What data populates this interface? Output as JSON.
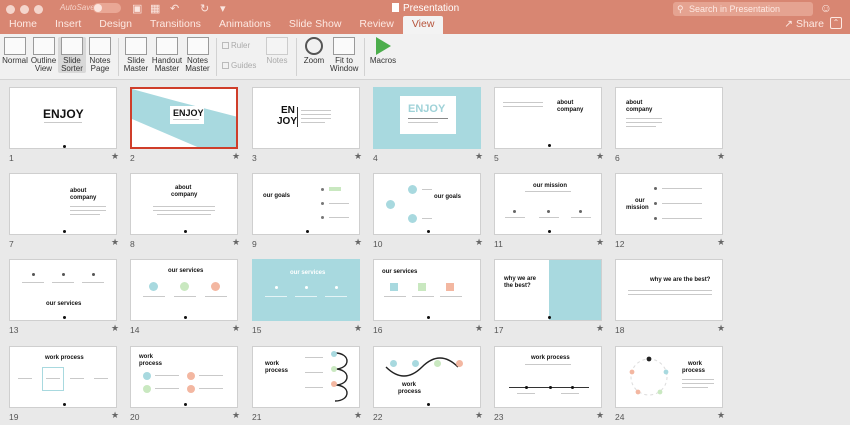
{
  "window": {
    "title": "Presentation",
    "autosave_label": "AutoSave",
    "toggle_label": "OFF",
    "search_placeholder": "Search in Presentation",
    "share_label": "Share"
  },
  "tabs": [
    "Home",
    "Insert",
    "Design",
    "Transitions",
    "Animations",
    "Slide Show",
    "Review",
    "View"
  ],
  "active_tab": "View",
  "ribbon": {
    "normal": "Normal",
    "outline_1": "Outline",
    "outline_2": "View",
    "sorter_1": "Slide",
    "sorter_2": "Sorter",
    "notes_page_1": "Notes",
    "notes_page_2": "Page",
    "slide_master_1": "Slide",
    "slide_master_2": "Master",
    "handout_master_1": "Handout",
    "handout_master_2": "Master",
    "notes_master_1": "Notes",
    "notes_master_2": "Master",
    "ruler": "Ruler",
    "guides": "Guides",
    "notes": "Notes",
    "zoom": "Zoom",
    "fit_1": "Fit to",
    "fit_2": "Window",
    "macros": "Macros"
  },
  "colors": {
    "titlebar": "#d88672",
    "accent_teal": "#a8d9df",
    "accent_green": "#c9e8c0",
    "accent_orange": "#f3b7a1",
    "selection": "#cf3e2a"
  },
  "slides": [
    {
      "number": "1",
      "starred": true,
      "text": [
        "ENJOY"
      ]
    },
    {
      "number": "2",
      "starred": true,
      "selected": true,
      "text": [
        "ENJOY"
      ]
    },
    {
      "number": "3",
      "starred": true,
      "text": [
        "EN",
        "JOY"
      ]
    },
    {
      "number": "4",
      "starred": true,
      "text": [
        "ENJOY"
      ]
    },
    {
      "number": "5",
      "starred": true,
      "text": [
        "about",
        "company"
      ]
    },
    {
      "number": "6",
      "starred": true,
      "text": [
        "about",
        "company"
      ]
    },
    {
      "number": "7",
      "starred": true,
      "text": [
        "about",
        "company"
      ]
    },
    {
      "number": "8",
      "starred": true,
      "text": [
        "about",
        "company"
      ]
    },
    {
      "number": "9",
      "starred": true,
      "text": [
        "our goals"
      ]
    },
    {
      "number": "10",
      "starred": true,
      "text": [
        "our goals"
      ]
    },
    {
      "number": "11",
      "starred": true,
      "text": [
        "our mission"
      ]
    },
    {
      "number": "12",
      "starred": true,
      "text": [
        "our",
        "mission"
      ]
    },
    {
      "number": "13",
      "starred": true,
      "text": [
        "our services"
      ]
    },
    {
      "number": "14",
      "starred": true,
      "text": [
        "our services"
      ]
    },
    {
      "number": "15",
      "starred": true,
      "text": [
        "our services"
      ]
    },
    {
      "number": "16",
      "starred": true,
      "text": [
        "our services"
      ]
    },
    {
      "number": "17",
      "starred": true,
      "text": [
        "why we are",
        "the best?"
      ]
    },
    {
      "number": "18",
      "starred": true,
      "text": [
        "why we are the best?"
      ]
    },
    {
      "number": "19",
      "starred": true,
      "text": [
        "work process"
      ]
    },
    {
      "number": "20",
      "starred": true,
      "text": [
        "work",
        "process"
      ]
    },
    {
      "number": "21",
      "starred": true,
      "text": [
        "work",
        "process"
      ]
    },
    {
      "number": "22",
      "starred": true,
      "text": [
        "work",
        "process"
      ]
    },
    {
      "number": "23",
      "starred": true,
      "text": [
        "work process"
      ]
    },
    {
      "number": "24",
      "starred": true,
      "text": [
        "work",
        "process"
      ]
    }
  ]
}
